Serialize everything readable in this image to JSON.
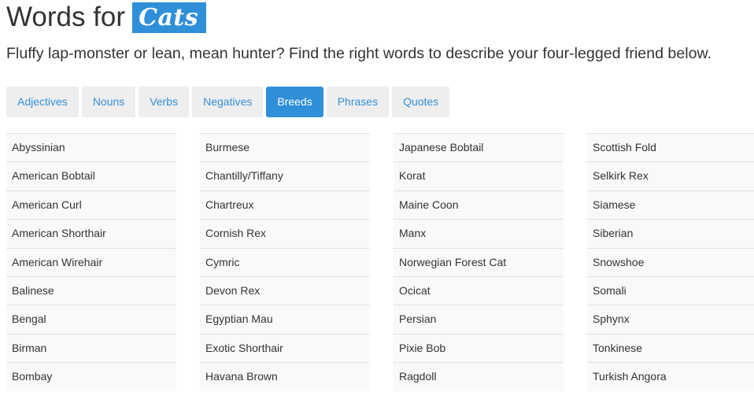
{
  "header": {
    "title_prefix": "Words for",
    "title_badge": "Cats",
    "subtitle": "Fluffy lap-monster or lean, mean hunter? Find the right words to describe your four-legged friend below."
  },
  "tabs": [
    {
      "label": "Adjectives",
      "active": false
    },
    {
      "label": "Nouns",
      "active": false
    },
    {
      "label": "Verbs",
      "active": false
    },
    {
      "label": "Negatives",
      "active": false
    },
    {
      "label": "Breeds",
      "active": true
    },
    {
      "label": "Phrases",
      "active": false
    },
    {
      "label": "Quotes",
      "active": false
    }
  ],
  "breeds": {
    "columns": [
      [
        "Abyssinian",
        "American Bobtail",
        "American Curl",
        "American Shorthair",
        "American Wirehair",
        "Balinese",
        "Bengal",
        "Birman",
        "Bombay"
      ],
      [
        "Burmese",
        "Chantilly/Tiffany",
        "Chartreux",
        "Cornish Rex",
        "Cymric",
        "Devon Rex",
        "Egyptian Mau",
        "Exotic Shorthair",
        "Havana Brown"
      ],
      [
        "Japanese Bobtail",
        "Korat",
        "Maine Coon",
        "Manx",
        "Norwegian Forest Cat",
        "Ocicat",
        "Persian",
        "Pixie Bob",
        "Ragdoll"
      ],
      [
        "Scottish Fold",
        "Selkirk Rex",
        "Siamese",
        "Siberian",
        "Snowshoe",
        "Somali",
        "Sphynx",
        "Tonkinese",
        "Turkish Angora"
      ]
    ]
  },
  "colors": {
    "accent": "#2f8fd8",
    "tab_text": "#3590d6",
    "tab_bg": "#eeeeee",
    "row_bg": "#f9f9f9"
  }
}
